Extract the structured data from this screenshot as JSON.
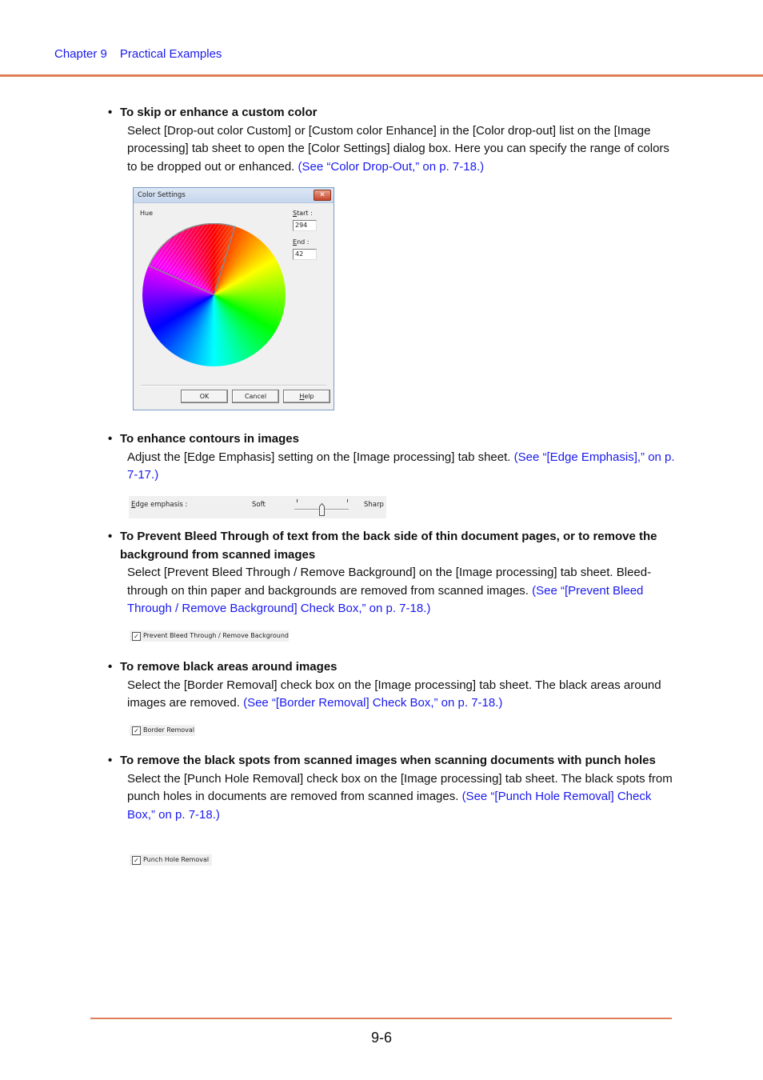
{
  "header": {
    "chapter": "Chapter 9",
    "title": "Practical Examples"
  },
  "colors": {
    "accent_rule": "#dd8057",
    "link": "#1a1aee"
  },
  "sections": [
    {
      "title": "To skip or enhance a custom color",
      "body": "Select [Drop-out color Custom] or [Custom color Enhance] in the [Color drop-out] list on the [Image processing] tab sheet to open the [Color Settings] dialog box. Here you can specify the range of colors to be dropped out or enhanced.",
      "link": "(See “Color Drop-Out,” on p. 7-18.)"
    },
    {
      "title": "To enhance contours in images",
      "body": "Adjust the [Edge Emphasis] setting on the [Image processing] tab sheet.",
      "link": "(See “[Edge Emphasis],” on p. 7-17.)"
    },
    {
      "title": "To Prevent Bleed Through of text from the back side of thin document pages, or to remove the background from scanned images",
      "body": "Select [Prevent Bleed Through / Remove Background] on the [Image processing] tab sheet. Bleed-through on thin paper and backgrounds are removed from scanned images.",
      "link": "(See “[Prevent Bleed Through / Remove Background] Check Box,” on p. 7-18.)"
    },
    {
      "title": "To remove black areas around images",
      "body": "Select the [Border Removal] check box on the [Image processing] tab sheet. The black areas around images are removed.",
      "link": "(See “[Border Removal] Check Box,” on p. 7-18.)"
    },
    {
      "title": "To remove the black spots from scanned images when scanning documents with punch holes",
      "body": "Select the [Punch Hole Removal] check box on the [Image processing] tab sheet. The black spots from punch holes in documents are removed from scanned images.",
      "link": "(See “[Punch Hole Removal] Check Box,” on p. 7-18.)"
    }
  ],
  "color_dialog": {
    "title": "Color Settings",
    "close_glyph": "✕",
    "hue_label": "Hue",
    "start_label": "Start :",
    "start_value": "294",
    "end_label": "End :",
    "end_value": "42",
    "buttons": {
      "ok": "OK",
      "cancel": "Cancel",
      "help": "Help"
    }
  },
  "edge_slider": {
    "label": "Edge emphasis :",
    "min_label": "Soft",
    "max_label": "Sharp",
    "value_fraction": 0.5
  },
  "checkboxes": {
    "bleed_through": {
      "label": "Prevent Bleed Through / Remove Background",
      "checked": true
    },
    "border_removal": {
      "label": "Border Removal",
      "checked": true
    },
    "punch_hole": {
      "label": "Punch Hole Removal",
      "checked": true
    }
  },
  "footer": {
    "page_number": "9-6"
  }
}
